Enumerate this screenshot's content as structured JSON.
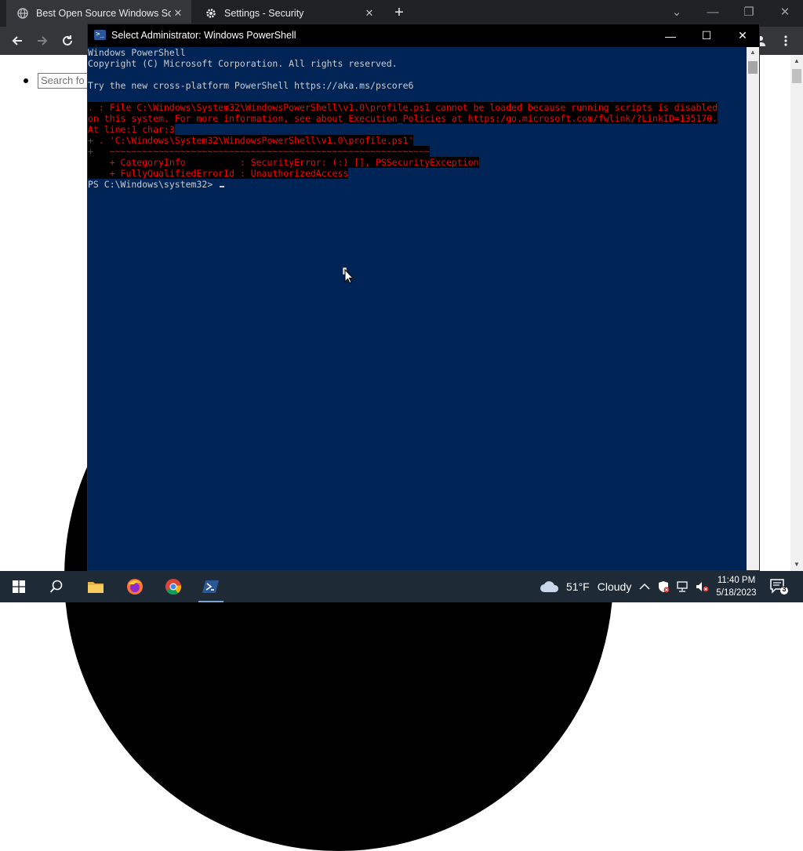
{
  "browser": {
    "tabs": [
      {
        "label": "Best Open Source Windows Soft",
        "icon": "globe-icon",
        "active": true
      },
      {
        "label": "Settings - Security",
        "icon": "gear-icon",
        "active": false
      }
    ],
    "new_tab_label": "+"
  },
  "page": {
    "search_placeholder": "Search fo"
  },
  "powershell": {
    "title": "Select Administrator: Windows PowerShell",
    "lines": [
      {
        "text": "Windows PowerShell",
        "type": "normal"
      },
      {
        "text": "Copyright (C) Microsoft Corporation. All rights reserved.",
        "type": "normal"
      },
      {
        "text": "",
        "type": "normal"
      },
      {
        "text": "Try the new cross-platform PowerShell https://aka.ms/pscore6",
        "type": "normal"
      },
      {
        "text": "",
        "type": "normal"
      },
      {
        "text": ". : File C:\\Windows\\System32\\WindowsPowerShell\\v1.0\\profile.ps1 cannot be loaded because running scripts is disabled",
        "type": "error"
      },
      {
        "text": "on this system. For more information, see about_Execution_Policies at https:/go.microsoft.com/fwlink/?LinkID=135170.",
        "type": "error"
      },
      {
        "text": "At line:1 char:3",
        "type": "error"
      },
      {
        "text": "+ . 'C:\\Windows\\System32\\WindowsPowerShell\\v1.0\\profile.ps1'",
        "type": "error"
      },
      {
        "text": "+   ~~~~~~~~~~~~~~~~~~~~~~~~~~~~~~~~~~~~~~~~~~~~~~~~~~~~~~~~~~~",
        "type": "error"
      },
      {
        "text": "    + CategoryInfo          : SecurityError: (:) [], PSSecurityException",
        "type": "error"
      },
      {
        "text": "    + FullyQualifiedErrorId : UnauthorizedAccess",
        "type": "error"
      }
    ],
    "prompt": "PS C:\\Windows\\system32> "
  },
  "taskbar": {
    "weather_temp": "51°F",
    "weather_desc": "Cloudy",
    "time": "11:40 PM",
    "date": "5/18/2023",
    "notification_count": "3"
  }
}
